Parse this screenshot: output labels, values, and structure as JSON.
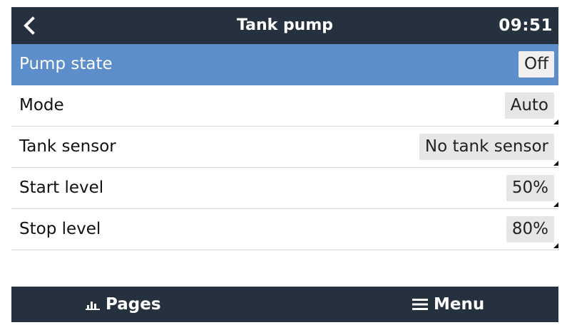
{
  "header": {
    "title": "Tank pump",
    "time": "09:51"
  },
  "rows": [
    {
      "label": "Pump state",
      "value": "Off"
    },
    {
      "label": "Mode",
      "value": "Auto"
    },
    {
      "label": "Tank sensor",
      "value": "No tank sensor"
    },
    {
      "label": "Start level",
      "value": "50%"
    },
    {
      "label": "Stop level",
      "value": "80%"
    }
  ],
  "footer": {
    "pages_label": "Pages",
    "menu_label": "Menu"
  },
  "colors": {
    "header_bg": "#26313f",
    "selected_row": "#5b8ecb",
    "value_bg": "#e6e6e6"
  },
  "icons": {
    "back": "chevron-left-icon",
    "pages": "bar-chart-icon",
    "menu": "hamburger-menu-icon"
  }
}
